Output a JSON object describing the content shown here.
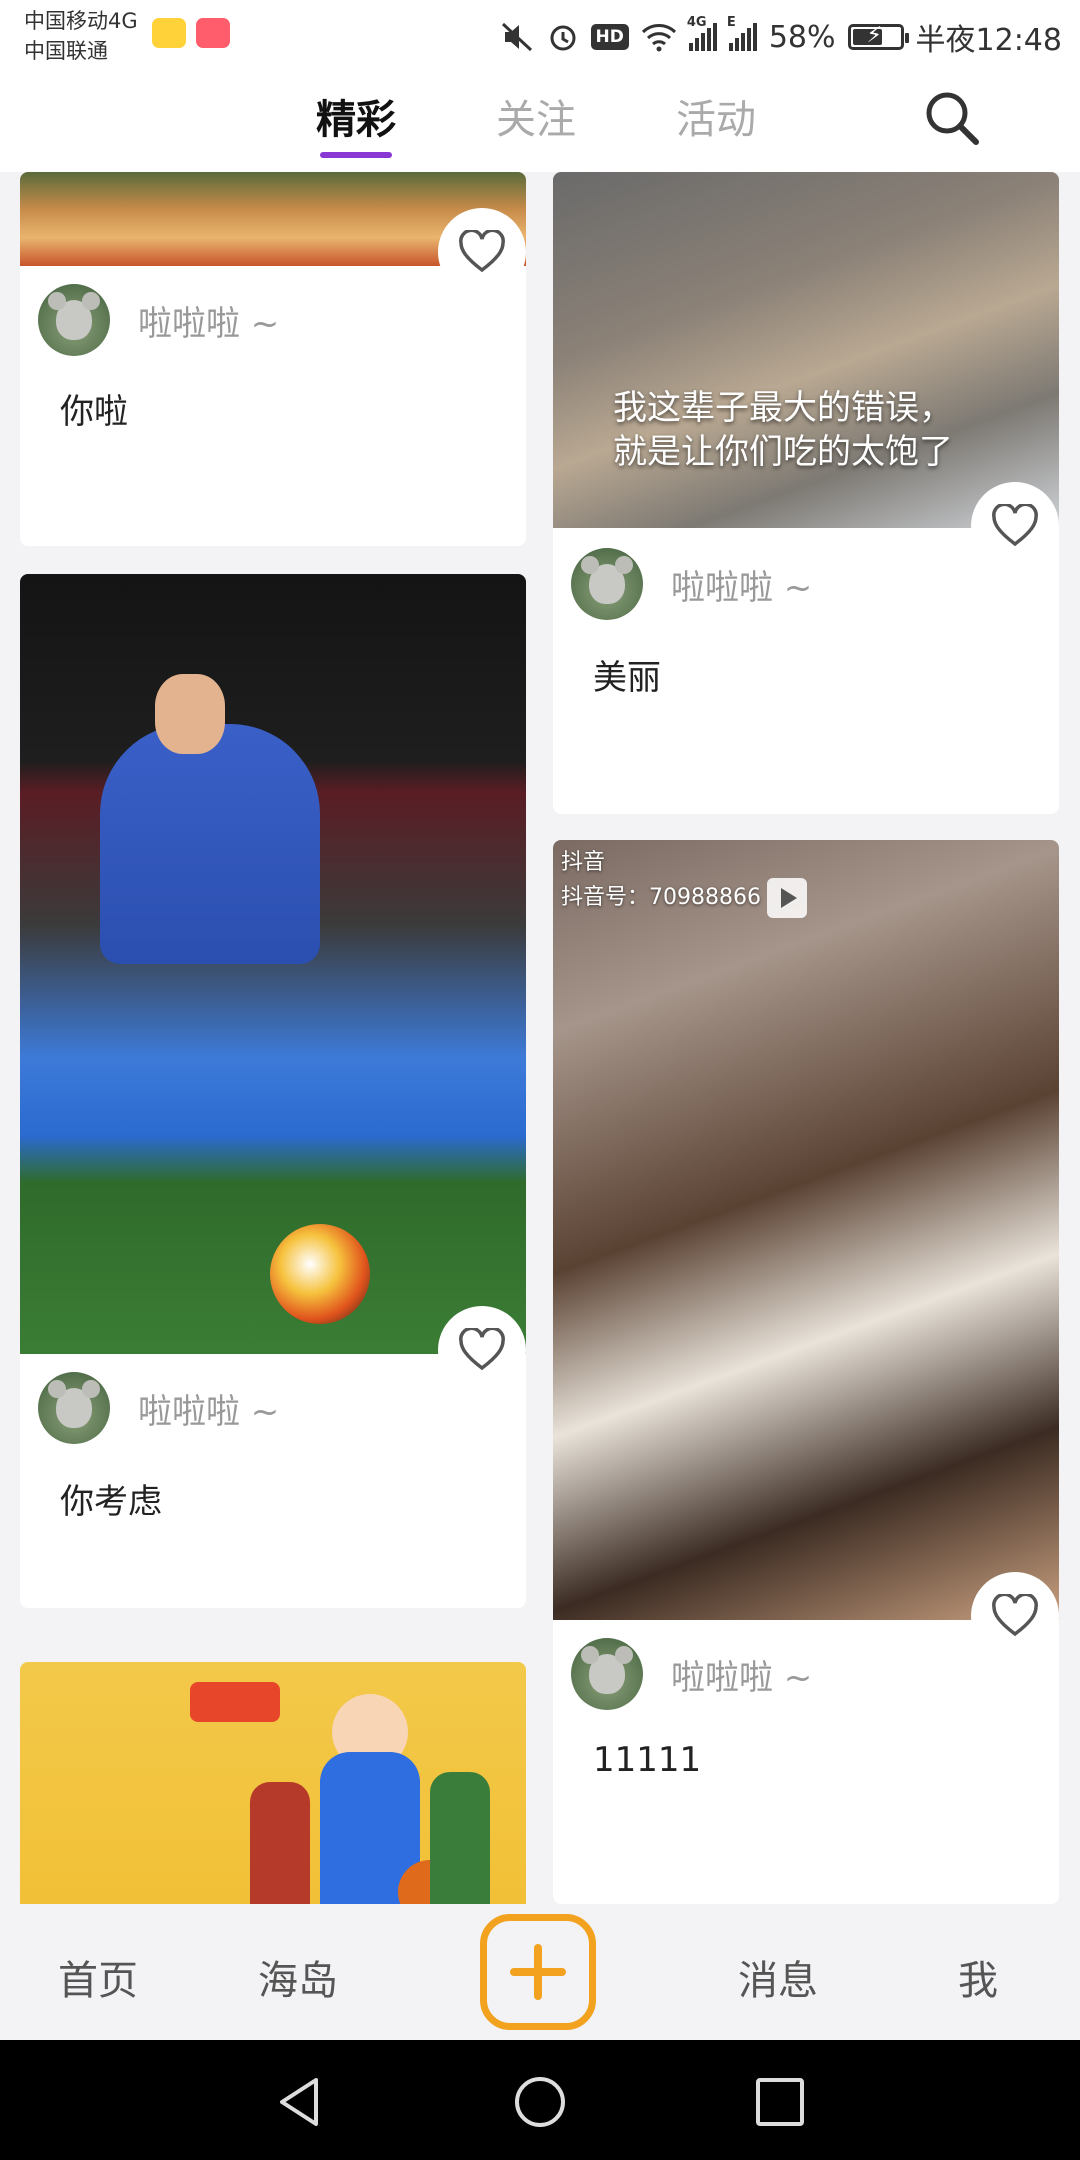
{
  "status_bar": {
    "carrier_1": "中国移动4G",
    "carrier_2": "中国联通",
    "hd": "HD",
    "net_1": "4G",
    "net_2": "E",
    "battery": "58%",
    "time": "半夜12:48"
  },
  "top_tabs": [
    {
      "label": "精彩",
      "active": true
    },
    {
      "label": "关注",
      "active": false
    },
    {
      "label": "活动",
      "active": false
    }
  ],
  "colors": {
    "accent": "#8a38d4",
    "add_button": "#f2a21e",
    "heart_outline": "#555555"
  },
  "feed": {
    "cards": [
      {
        "author": "啦啦啦 ~",
        "caption": "你啦"
      },
      {
        "author": "啦啦啦 ~",
        "caption": "美丽",
        "overlay": [
          "我这辈子最大的错误，",
          "就是让你们吃的太饱了"
        ]
      },
      {
        "author": "啦啦啦 ~",
        "caption": "你考虑"
      },
      {
        "author": "啦啦啦 ~",
        "caption": "11111",
        "watermark": "抖音",
        "watermark_id": "抖音号：70988866"
      }
    ]
  },
  "bottom_nav": {
    "home": "首页",
    "island": "海岛",
    "add": "+",
    "messages": "消息",
    "me": "我"
  }
}
